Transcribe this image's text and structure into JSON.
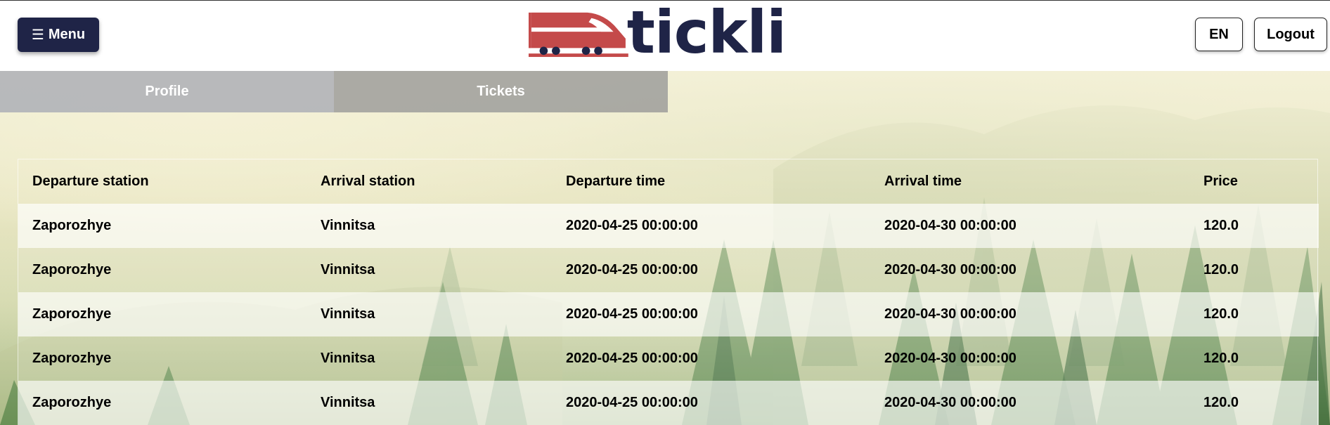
{
  "header": {
    "menu_icon": "☰",
    "menu_label": "Menu",
    "logo_text": "tickli",
    "lang_label": "EN",
    "logout_label": "Logout",
    "colors": {
      "navy": "#1f2447",
      "logo_red": "#c44a4a"
    }
  },
  "tabs": [
    {
      "label": "Profile"
    },
    {
      "label": "Tickets"
    }
  ],
  "table": {
    "columns": [
      "Departure station",
      "Arrival station",
      "Departure time",
      "Arrival time",
      "Price"
    ],
    "rows": [
      [
        "Zaporozhye",
        "Vinnitsa",
        "2020-04-25 00:00:00",
        "2020-04-30 00:00:00",
        "120.0"
      ],
      [
        "Zaporozhye",
        "Vinnitsa",
        "2020-04-25 00:00:00",
        "2020-04-30 00:00:00",
        "120.0"
      ],
      [
        "Zaporozhye",
        "Vinnitsa",
        "2020-04-25 00:00:00",
        "2020-04-30 00:00:00",
        "120.0"
      ],
      [
        "Zaporozhye",
        "Vinnitsa",
        "2020-04-25 00:00:00",
        "2020-04-30 00:00:00",
        "120.0"
      ],
      [
        "Zaporozhye",
        "Vinnitsa",
        "2020-04-25 00:00:00",
        "2020-04-30 00:00:00",
        "120.0"
      ]
    ]
  }
}
